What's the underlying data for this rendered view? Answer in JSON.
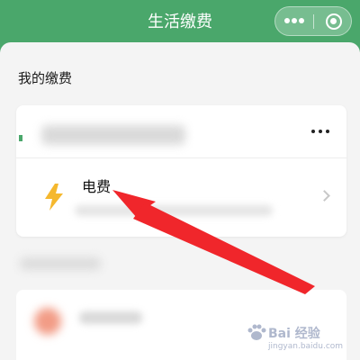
{
  "header": {
    "title": "生活缴费",
    "more_icon": "more-dots-icon",
    "close_icon": "close-target-icon",
    "color": "#4aa76b"
  },
  "section": {
    "title": "我的缴费"
  },
  "card": {
    "more_icon": "more-horizontal-icon",
    "item": {
      "label": "电费",
      "icon": "lightning-bolt-icon",
      "icon_color": "#f5b82e",
      "chevron_icon": "chevron-right-icon"
    }
  },
  "annotation": {
    "arrow_color": "#f0262b"
  },
  "watermark": {
    "brand_text": "Bai 经验",
    "url_text": "jingyan.baidu.com"
  }
}
